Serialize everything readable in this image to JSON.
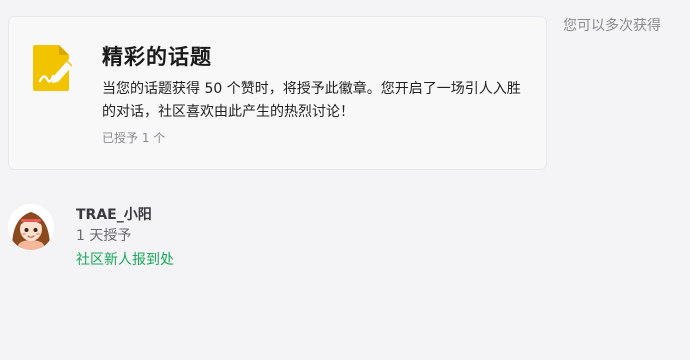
{
  "badge": {
    "icon": "pencil-document-icon",
    "icon_color": "#f2c300",
    "title": "精彩的话题",
    "description": "当您的话题获得 50 个赞时，将授予此徽章。您开启了一场引人入胜的对话，社区喜欢由此产生的热烈讨论！",
    "granted_count": "已授予 1 个"
  },
  "multi_earn_note": "您可以多次获得",
  "grants": [
    {
      "avatar_icon": "user-avatar",
      "username": "TRAE_小阳",
      "time": "1 天授予",
      "topic_link": "社区新人报到处",
      "link_color": "#1aa85a"
    }
  ]
}
